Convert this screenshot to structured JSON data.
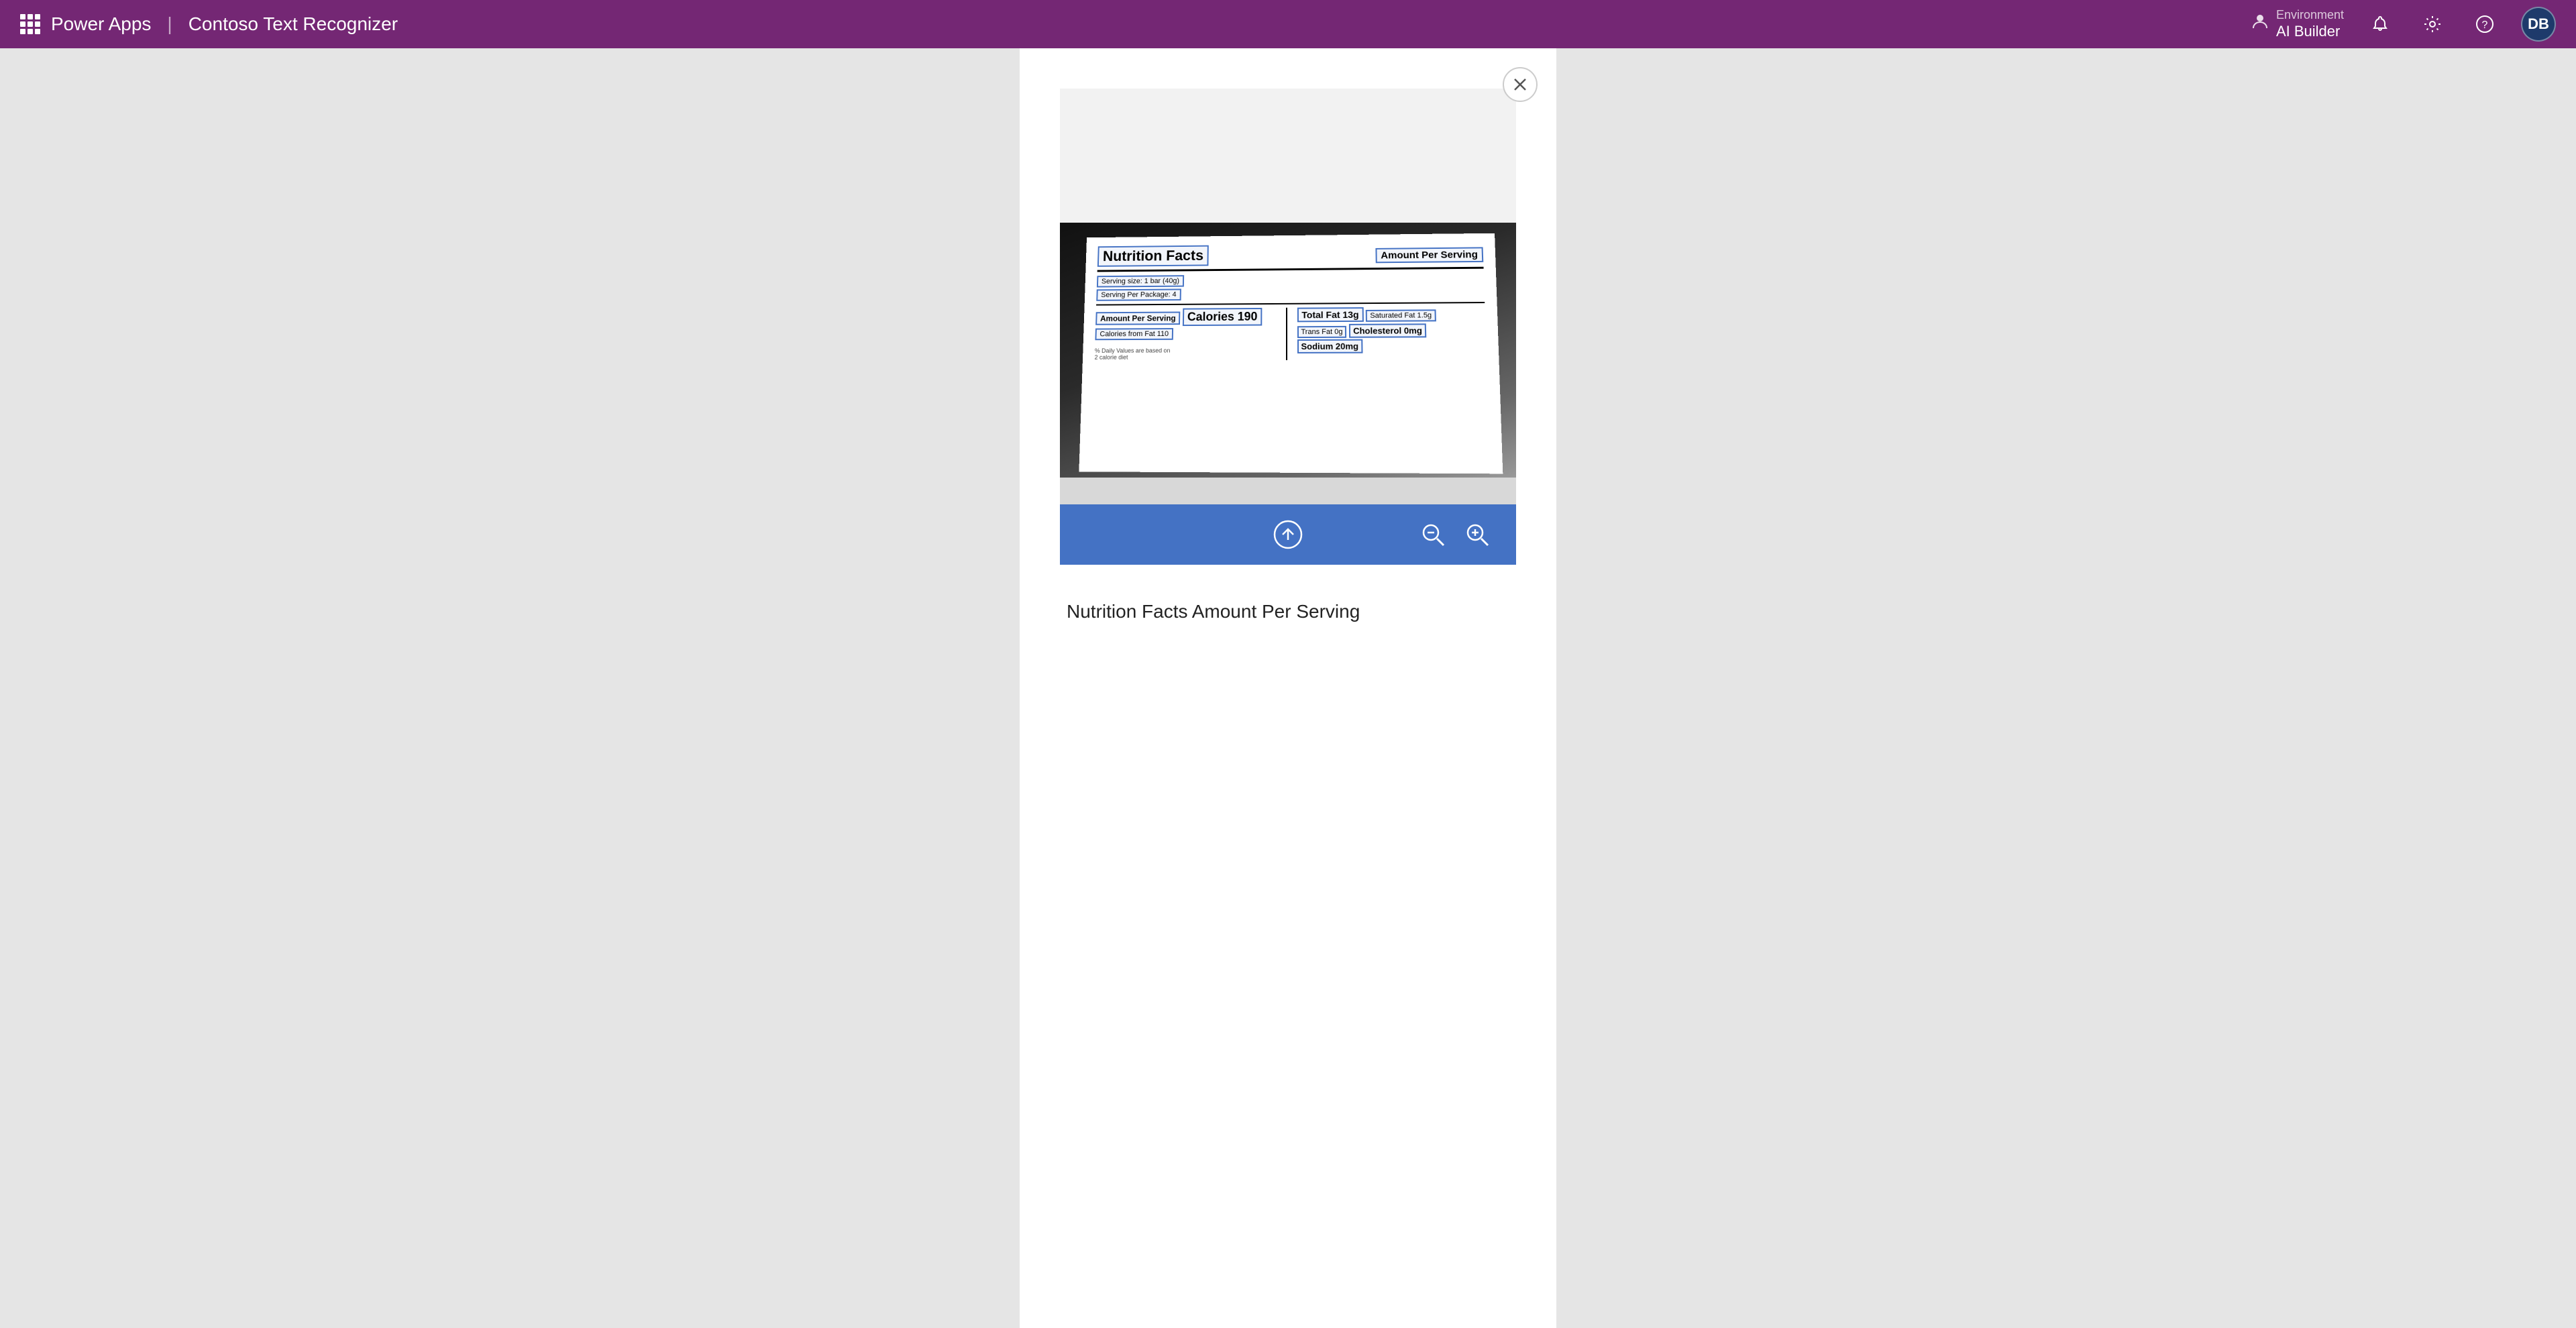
{
  "topbar": {
    "app_name": "Power Apps",
    "separator": "|",
    "app_subtitle": "Contoso Text Recognizer",
    "env": {
      "label": "Environment",
      "name": "AI Builder"
    },
    "avatar": "DB"
  },
  "panel": {
    "close_label": "×",
    "result_text": "Nutrition Facts Amount Per Serving"
  },
  "toolbar": {
    "upload_icon": "upload",
    "zoom_out_icon": "zoom-out",
    "zoom_in_icon": "zoom-in"
  },
  "nutrition_label": {
    "title": "Nutrition Facts",
    "amount_per_serving": "Amount Per Serving",
    "rows": [
      {
        "label": "Serving size: 1 bar (40g)",
        "highlighted": true
      },
      {
        "label": "Serving Per Package: 4",
        "highlighted": true
      },
      {
        "label": "Amount Per Serving",
        "highlighted": true
      },
      {
        "label": "Calories 190",
        "highlighted": true
      },
      {
        "label": "Calories from Fat 110",
        "highlighted": true
      },
      {
        "label": "% Daily Values are based on",
        "highlighted": false
      },
      {
        "label": "2 calorie diet",
        "highlighted": false
      }
    ],
    "right_rows": [
      {
        "label": "Total Fat 13g",
        "highlighted": true
      },
      {
        "label": "Saturated Fat 1.5g",
        "highlighted": true
      },
      {
        "label": "Trans Fat 0g",
        "highlighted": true
      },
      {
        "label": "Cholesterol 0mg",
        "highlighted": true
      },
      {
        "label": "Sodium 20mg",
        "highlighted": true
      }
    ]
  }
}
